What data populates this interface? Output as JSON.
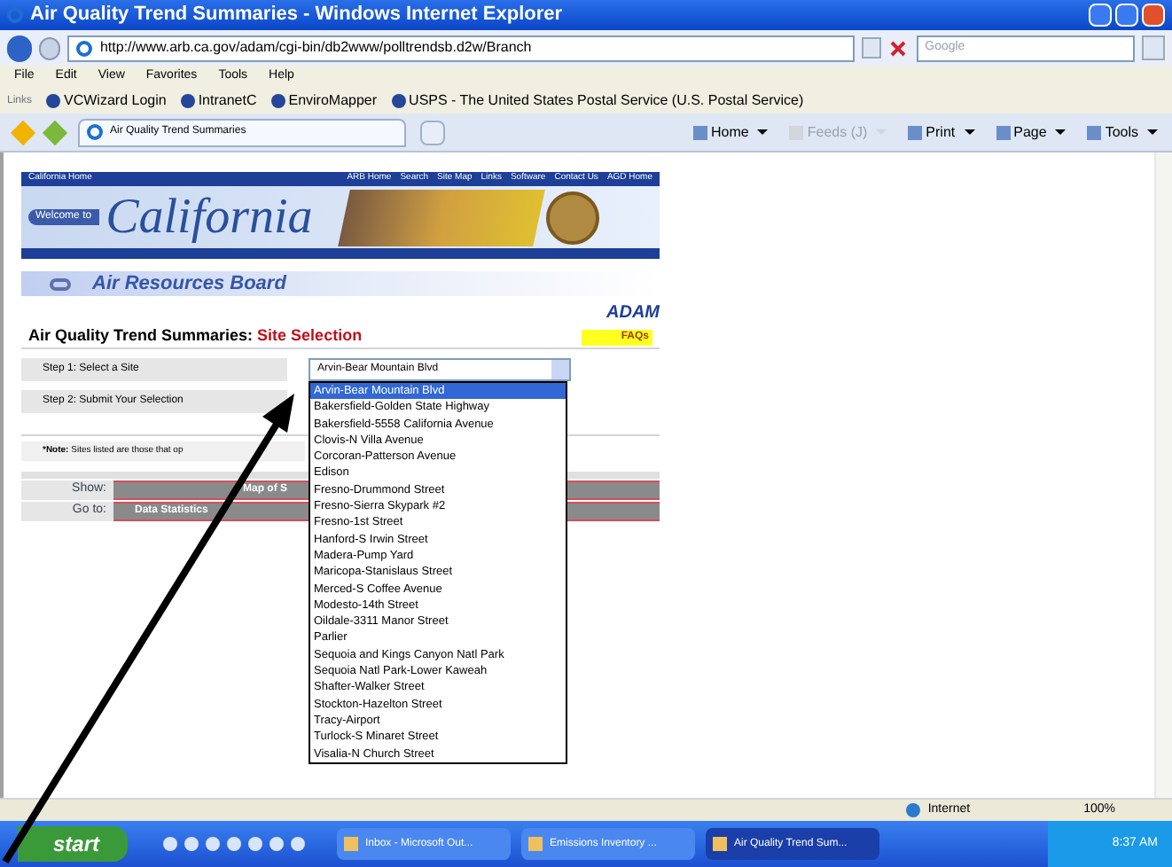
{
  "window": {
    "title": "Air Quality Trend Summaries - Windows Internet Explorer"
  },
  "address_bar": {
    "url": "http://www.arb.ca.gov/adam/cgi-bin/db2www/polltrendsb.d2w/Branch",
    "search_placeholder": "Google"
  },
  "menu": [
    "File",
    "Edit",
    "View",
    "Favorites",
    "Tools",
    "Help"
  ],
  "links_bar": {
    "label": "Links",
    "items": [
      "VCWizard Login",
      "IntranetC",
      "EnviroMapper",
      "USPS - The United States Postal Service (U.S. Postal Service)"
    ]
  },
  "tabs": [
    {
      "label": "Air Quality Trend Summaries",
      "selected": true
    }
  ],
  "command_bar": [
    {
      "label": "Home",
      "disabled": false
    },
    {
      "label": "Feeds (J)",
      "disabled": true
    },
    {
      "label": "Print",
      "disabled": false
    },
    {
      "label": "Page",
      "disabled": false
    },
    {
      "label": "Tools",
      "disabled": false
    }
  ],
  "page": {
    "nav_left": "California Home",
    "nav_links": [
      "ARB Home",
      "Search",
      "Site Map",
      "Links",
      "Software",
      "Contact Us",
      "AGD Home"
    ],
    "banner": {
      "welcome": "Welcome to",
      "state": "California"
    },
    "agency": "Air Resources Board",
    "logo": "ADAM",
    "faq": "FAQs",
    "heading": {
      "title": "Air Quality Trend Summaries:",
      "subtitle": "Site Selection"
    },
    "steps": [
      {
        "label": "Step 1:",
        "text": "Select a Site"
      },
      {
        "label": "Step 2:",
        "text": "Submit Your Selection"
      }
    ],
    "site_select": {
      "value": "Arvin-Bear Mountain Blvd",
      "expanded": true,
      "options": [
        {
          "label": "Arvin-Bear Mountain Blvd",
          "selected": true
        },
        {
          "label": "Bakersfield-Golden State Highway",
          "selected": false
        },
        {
          "label": "Bakersfield-5558 California Avenue",
          "selected": false
        },
        {
          "label": "Clovis-N Villa Avenue",
          "selected": false
        },
        {
          "label": "Corcoran-Patterson Avenue",
          "selected": false
        },
        {
          "label": "Edison",
          "selected": false
        },
        {
          "label": "Fresno-Drummond Street",
          "selected": false
        },
        {
          "label": "Fresno-Sierra Skypark #2",
          "selected": false
        },
        {
          "label": "Fresno-1st Street",
          "selected": false
        },
        {
          "label": "Hanford-S Irwin Street",
          "selected": false
        },
        {
          "label": "Madera-Pump Yard",
          "selected": false
        },
        {
          "label": "Maricopa-Stanislaus Street",
          "selected": false
        },
        {
          "label": "Merced-S Coffee Avenue",
          "selected": false
        },
        {
          "label": "Modesto-14th Street",
          "selected": false
        },
        {
          "label": "Oildale-3311 Manor Street",
          "selected": false
        },
        {
          "label": "Parlier",
          "selected": false
        },
        {
          "label": "Sequoia and Kings Canyon Natl Park",
          "selected": false
        },
        {
          "label": "Sequoia Natl Park-Lower Kaweah",
          "selected": false
        },
        {
          "label": "Shafter-Walker Street",
          "selected": false
        },
        {
          "label": "Stockton-Hazelton Street",
          "selected": false
        },
        {
          "label": "Tracy-Airport",
          "selected": false
        },
        {
          "label": "Turlock-S Minaret Street",
          "selected": false
        },
        {
          "label": "Visalia-N Church Street",
          "selected": false
        }
      ]
    },
    "note": {
      "label": "*Note:",
      "text": "Sites listed are those that op"
    },
    "show": {
      "label": "Show:",
      "button": "Map of S"
    },
    "goto": {
      "label": "Go to:",
      "button": "Data Statistics"
    }
  },
  "status_bar": {
    "zone": "Internet",
    "zoom": "100%"
  },
  "taskbar": {
    "start": "start",
    "tasks": [
      {
        "label": "Inbox - Microsoft Out...",
        "selected": false
      },
      {
        "label": "Emissions Inventory ...",
        "selected": false
      },
      {
        "label": "Air Quality Trend Sum...",
        "selected": true
      }
    ],
    "clock": "8:37 AM"
  }
}
